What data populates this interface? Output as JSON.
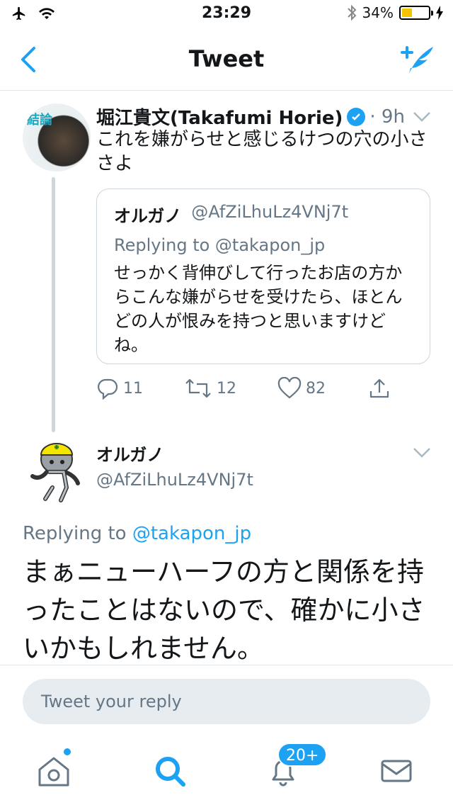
{
  "status_bar": {
    "time": "23:29",
    "battery": "34%",
    "battery_level": 0.34
  },
  "nav": {
    "title": "Tweet",
    "icons": [
      "chevron-left-icon",
      "compose-tweet-icon"
    ]
  },
  "tweet": {
    "author_name": "堀江貴文(Takafumi Horie)",
    "time": "· 9h",
    "text": "これを嫌がらせと感じるけつの穴の小ささよ",
    "avatar_text": "結論",
    "quote": {
      "name": "オルガノ",
      "handle": "@AfZiLhuLz4VNj7t",
      "replying": "Replying to @takapon_jp",
      "text": "せっかく背伸びして行ったお店の方からこんな嫌がらせを受けたら、ほとんどの人が恨みを持つと思いますけどね。"
    },
    "actions": {
      "replies": "11",
      "retweets": "12",
      "likes": "82"
    }
  },
  "reply": {
    "author_name": "オルガノ",
    "handle": "@AfZiLhuLz4VNj7t",
    "replying_prefix": "Replying to",
    "replying_to": "@takapon_jp",
    "text": "まぁニューハーフの方と関係を持ったことはないので、確かに小さいかもしれません。"
  },
  "composer": {
    "placeholder": "Tweet your reply"
  },
  "tabbar": {
    "notifications_badge": "20+",
    "accent": "#1da1f2"
  }
}
